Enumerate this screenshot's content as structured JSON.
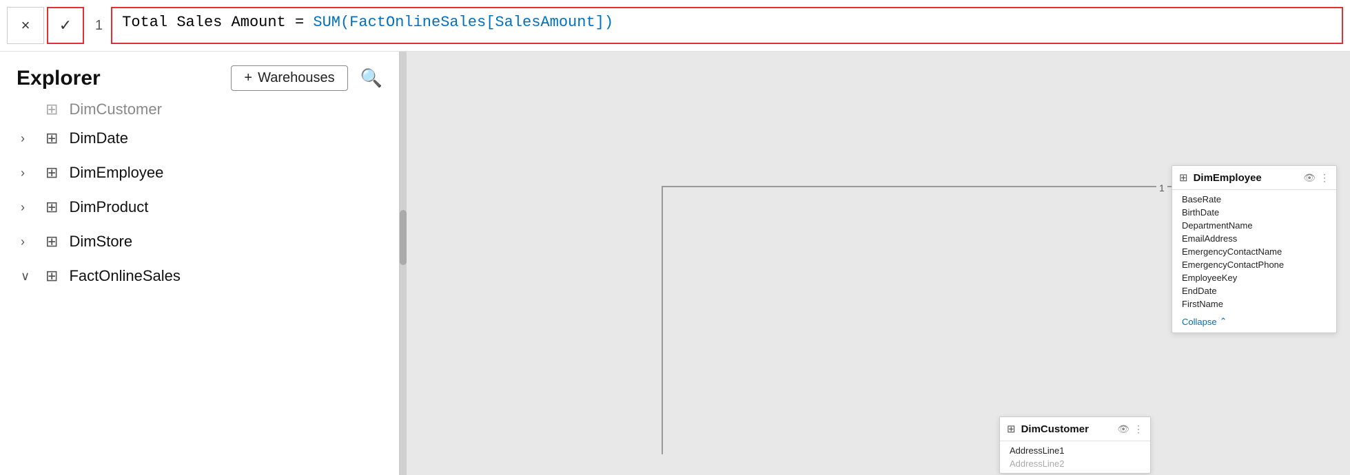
{
  "formula_bar": {
    "line_number": "1",
    "formula_text_plain": "Total Sales Amount = ",
    "formula_text_blue": "SUM(FactOnlineSales[SalesAmount])",
    "cancel_label": "×",
    "confirm_label": "✓"
  },
  "sidebar": {
    "title": "Explorer",
    "warehouses_label": "Warehouses",
    "add_icon": "+",
    "items": [
      {
        "id": "dim-customer-partial",
        "label": "DimCustomer",
        "chevron": "",
        "partial": true
      },
      {
        "id": "dim-date",
        "label": "DimDate",
        "chevron": "›",
        "partial": false
      },
      {
        "id": "dim-employee",
        "label": "DimEmployee",
        "chevron": "›",
        "partial": false
      },
      {
        "id": "dim-product",
        "label": "DimProduct",
        "chevron": "›",
        "partial": false
      },
      {
        "id": "dim-store",
        "label": "DimStore",
        "chevron": "›",
        "partial": false
      },
      {
        "id": "fact-online-sales",
        "label": "FactOnlineSales",
        "chevron": "∨",
        "partial": false
      }
    ]
  },
  "canvas": {
    "dim_employee_card": {
      "title": "DimEmployee",
      "fields": [
        "BaseRate",
        "BirthDate",
        "DepartmentName",
        "EmailAddress",
        "EmergencyContactName",
        "EmergencyContactPhone",
        "EmployeeKey",
        "EndDate",
        "FirstName"
      ],
      "collapse_label": "Collapse"
    },
    "dim_customer_card": {
      "title": "DimCustomer",
      "fields": [
        "AddressLine1",
        "AddressLine2"
      ]
    }
  }
}
